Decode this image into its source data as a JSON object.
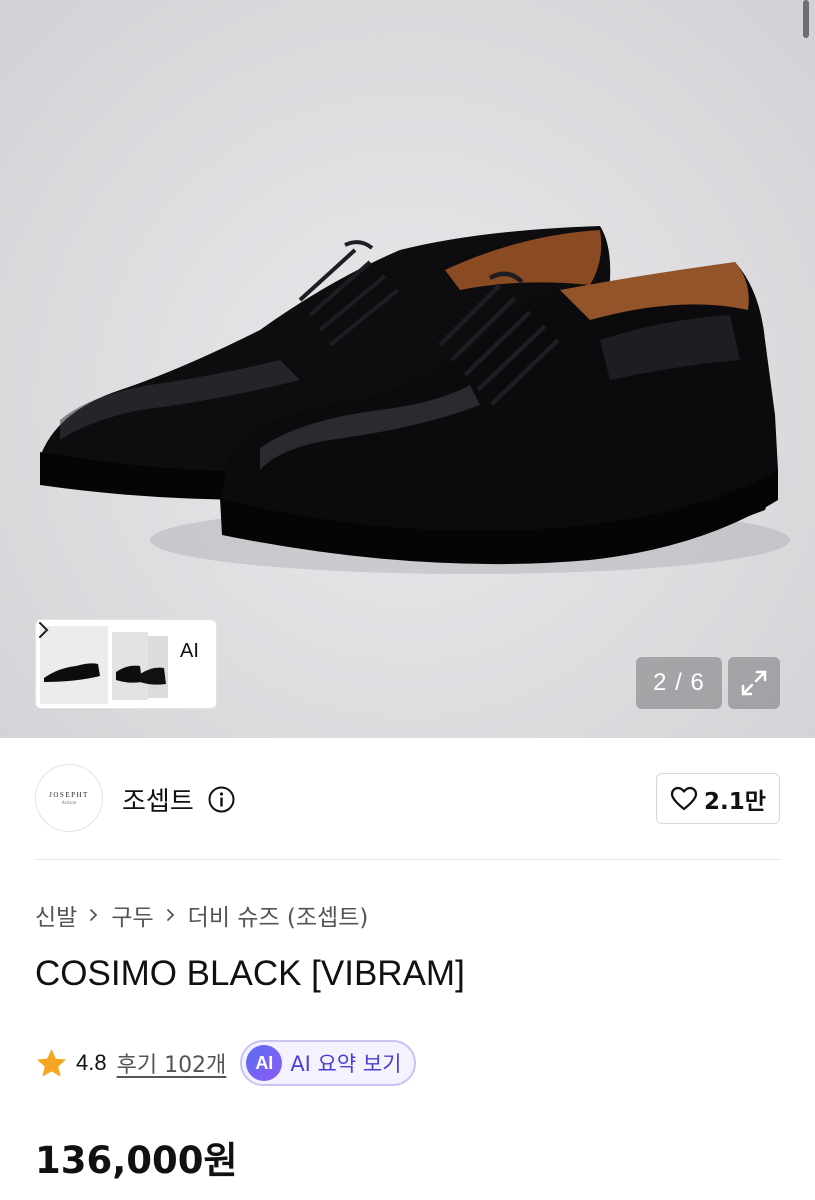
{
  "gallery": {
    "thumb_ai_label": "AI",
    "counter": "2 / 6"
  },
  "brand": {
    "logo_text": "JOSEPHT",
    "logo_subtext": "Artisan",
    "name": "조셉트",
    "like_count": "2.1만"
  },
  "breadcrumb": [
    "신발",
    "구두",
    "더비 슈즈 (조셉트)"
  ],
  "product": {
    "title": "COSIMO BLACK [VIBRAM]",
    "rating": "4.8",
    "review_link": "후기 102개",
    "ai_badge": "AI",
    "ai_summary_label": "AI 요약 보기",
    "price": "136,000원"
  },
  "colors": {
    "accent_ai": "#4b3fd1",
    "star": "#f5a623"
  },
  "icons": {
    "info": "info-circle-icon",
    "like": "heart-icon",
    "expand": "expand-icon",
    "star": "star-icon",
    "chevron": "chevron-right-icon"
  }
}
